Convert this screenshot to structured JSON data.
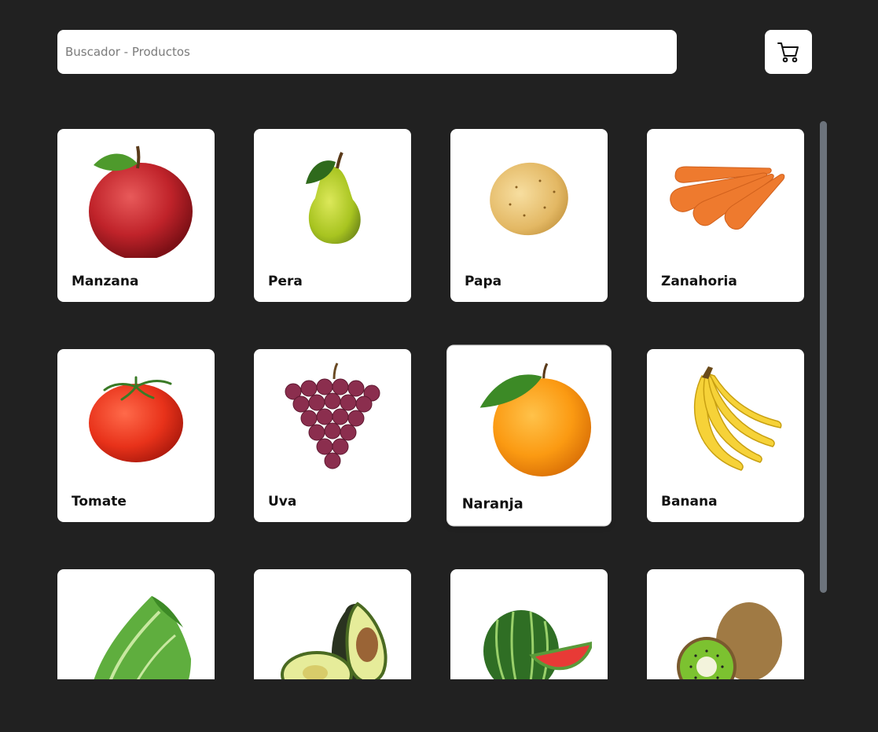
{
  "search": {
    "placeholder": "Buscador - Productos",
    "value": ""
  },
  "cart": {
    "icon": "shopping-cart-icon"
  },
  "products": [
    {
      "name": "Manzana",
      "icon": "apple-icon"
    },
    {
      "name": "Pera",
      "icon": "pear-icon"
    },
    {
      "name": "Papa",
      "icon": "potato-icon"
    },
    {
      "name": "Zanahoria",
      "icon": "carrot-icon"
    },
    {
      "name": "Tomate",
      "icon": "tomato-icon"
    },
    {
      "name": "Uva",
      "icon": "grapes-icon"
    },
    {
      "name": "Naranja",
      "icon": "orange-icon"
    },
    {
      "name": "Banana",
      "icon": "banana-icon"
    },
    {
      "name": "",
      "icon": "lettuce-icon"
    },
    {
      "name": "",
      "icon": "avocado-icon"
    },
    {
      "name": "",
      "icon": "watermelon-icon"
    },
    {
      "name": "",
      "icon": "kiwi-icon"
    }
  ],
  "colors": {
    "background": "#212121",
    "card": "#ffffff",
    "scrollbar": "#6c737c"
  }
}
